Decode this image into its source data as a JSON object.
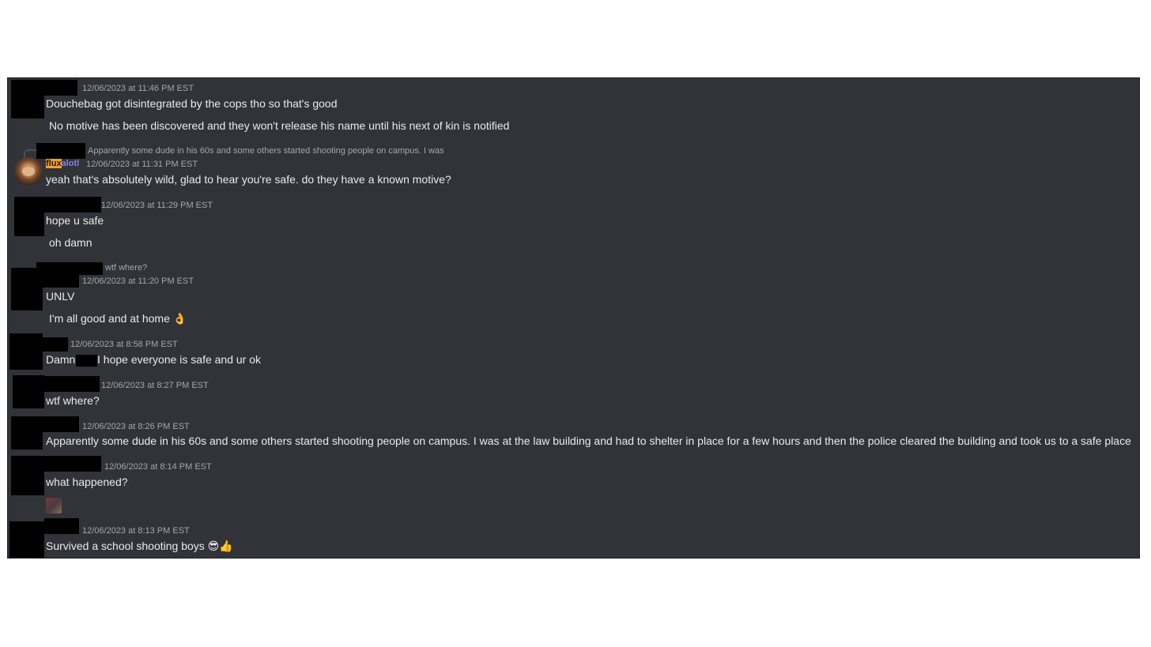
{
  "messages": [
    {
      "timestamp": "12/06/2023 at 11:46 PM EST",
      "lines": [
        "Douchebag got disintegrated by the cops tho so that's good",
        "No motive has been discovered and they won't release his name until his next of kin is notified"
      ]
    },
    {
      "reply_preview": "Apparently some dude in his 60s and some others started shooting people on campus. I was",
      "username_part1": "flux",
      "username_part2": "alotl",
      "timestamp": "12/06/2023 at 11:31 PM EST",
      "lines": [
        "yeah that's absolutely wild, glad to hear you're safe. do they have a known motive?"
      ]
    },
    {
      "timestamp": "12/06/2023 at 11:29 PM EST",
      "lines": [
        "hope u safe",
        "oh damn"
      ]
    },
    {
      "reply_preview": "wtf where?",
      "timestamp": "12/06/2023 at 11:20 PM EST",
      "lines": [
        "UNLV",
        "I'm all good and at home 👌"
      ]
    },
    {
      "timestamp": "12/06/2023 at 8:58 PM EST",
      "line_before": "Damn",
      "line_after": "I hope everyone is safe and ur ok"
    },
    {
      "timestamp": "12/06/2023 at 8:27 PM EST",
      "lines": [
        "wtf where?"
      ]
    },
    {
      "timestamp": "12/06/2023 at 8:26 PM EST",
      "lines": [
        "Apparently some dude in his 60s and some others started shooting people on campus. I was at the law building and had to shelter in place for a few hours and then the police cleared the building and took us to a safe place"
      ]
    },
    {
      "timestamp": "12/06/2023 at 8:14 PM EST",
      "lines": [
        "what happened?"
      ]
    },
    {
      "timestamp": "12/06/2023 at 8:13 PM EST",
      "lines": [
        "Survived a school shooting boys 😎👍"
      ]
    }
  ],
  "colors": {
    "background": "#323339",
    "text": "#e9eaed",
    "muted": "#a4a6ab",
    "redaction": "#000000",
    "name_highlight": "#f0a030",
    "name_purple": "#8a7bff"
  },
  "icons": [
    "redaction-block",
    "avatar-image",
    "reply-connector",
    "image-attachment"
  ]
}
